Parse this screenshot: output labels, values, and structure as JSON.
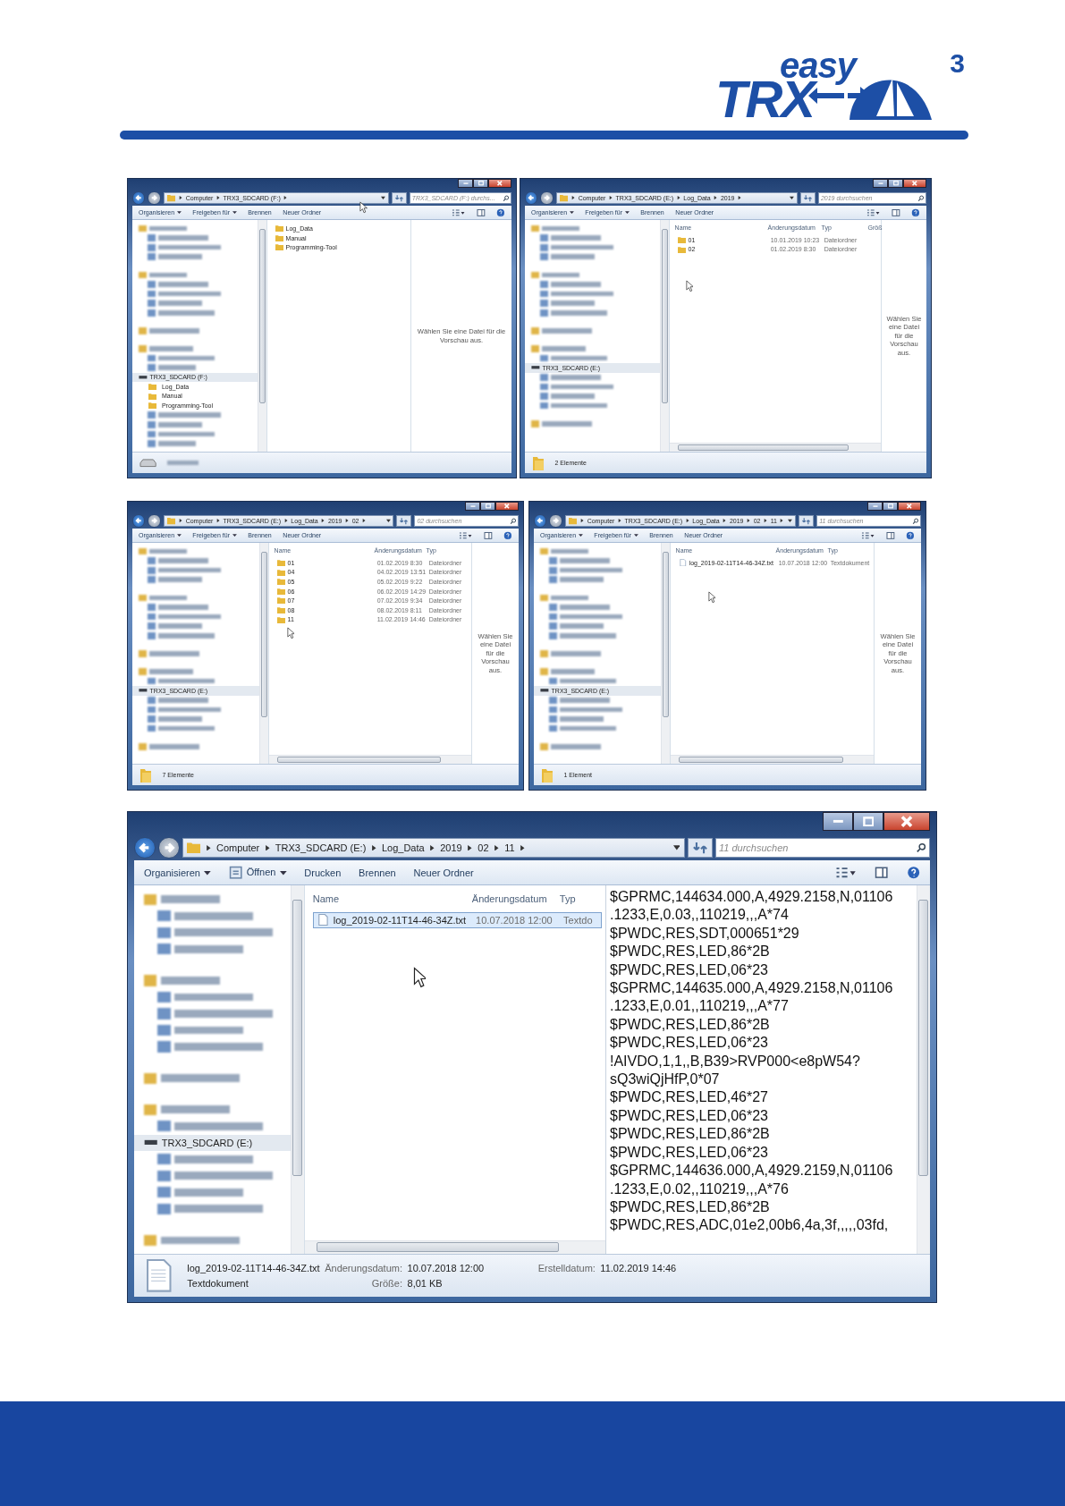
{
  "logo": {
    "top": "easy",
    "main": "TRX",
    "sup": "3"
  },
  "windows": [
    {
      "breadcrumbs": [
        "Computer",
        "TRX3_SDCARD (F:)"
      ],
      "search": {
        "placeholder": "TRX3_SDCARD (F:) durchs..."
      },
      "toolbar": [
        {
          "label": "Organisieren",
          "menu": true
        },
        {
          "label": "Freigeben für",
          "menu": true
        },
        {
          "label": "Brennen",
          "menu": false
        },
        {
          "label": "Neuer Ordner",
          "menu": false
        }
      ],
      "sidebar": [
        {
          "kind": "group"
        },
        {
          "kind": "blurred"
        },
        {
          "kind": "blurred"
        },
        {
          "kind": "blurred"
        },
        {
          "kind": "gap"
        },
        {
          "kind": "group"
        },
        {
          "kind": "blurred"
        },
        {
          "kind": "blurred"
        },
        {
          "kind": "blurred"
        },
        {
          "kind": "blurred"
        },
        {
          "kind": "gap"
        },
        {
          "kind": "group"
        },
        {
          "kind": "gap"
        },
        {
          "kind": "group"
        },
        {
          "kind": "blurred"
        },
        {
          "kind": "blurred"
        },
        {
          "kind": "drive",
          "label": "TRX3_SDCARD (F:)",
          "selected": true,
          "children": [
            {
              "label": "Log_Data"
            },
            {
              "label": "Manual"
            },
            {
              "label": "Programming-Tool"
            }
          ]
        },
        {
          "kind": "blurred"
        },
        {
          "kind": "blurred"
        },
        {
          "kind": "blurred"
        },
        {
          "kind": "blurred"
        }
      ],
      "rows": [
        {
          "kind": "folder",
          "name": "Log_Data",
          "selected": false
        },
        {
          "kind": "folder",
          "name": "Manual",
          "selected": false
        },
        {
          "kind": "folder",
          "name": "Programming-Tool",
          "selected": false
        }
      ],
      "preview": {
        "kind": "hint",
        "text": "Wählen Sie eine Datei für die Vorschau aus."
      },
      "status": {
        "kind": "drive"
      }
    },
    {
      "breadcrumbs": [
        "Computer",
        "TRX3_SDCARD (E:)",
        "Log_Data",
        "2019"
      ],
      "search": {
        "placeholder": "2019 durchsuchen"
      },
      "toolbar": [
        {
          "label": "Organisieren",
          "menu": true
        },
        {
          "label": "Freigeben für",
          "menu": true
        },
        {
          "label": "Brennen",
          "menu": false
        },
        {
          "label": "Neuer Ordner",
          "menu": false
        }
      ],
      "sidebar": [
        {
          "kind": "group"
        },
        {
          "kind": "blurred"
        },
        {
          "kind": "blurred"
        },
        {
          "kind": "blurred"
        },
        {
          "kind": "gap"
        },
        {
          "kind": "group"
        },
        {
          "kind": "blurred"
        },
        {
          "kind": "blurred"
        },
        {
          "kind": "blurred"
        },
        {
          "kind": "blurred"
        },
        {
          "kind": "gap"
        },
        {
          "kind": "group"
        },
        {
          "kind": "gap"
        },
        {
          "kind": "group"
        },
        {
          "kind": "blurred"
        },
        {
          "kind": "drive",
          "label": "TRX3_SDCARD (E:)",
          "selected": true
        },
        {
          "kind": "blurred"
        },
        {
          "kind": "blurred"
        },
        {
          "kind": "blurred"
        },
        {
          "kind": "blurred"
        },
        {
          "kind": "gap"
        },
        {
          "kind": "group"
        }
      ],
      "columns": [
        "Name",
        "Änderungsdatum",
        "Typ",
        "Größ"
      ],
      "rows": [
        {
          "kind": "folder",
          "name": "01",
          "date": "10.01.2019 10:23",
          "type": "Dateiordner",
          "selected": false
        },
        {
          "kind": "folder",
          "name": "02",
          "date": "01.02.2019 8:30",
          "type": "Dateiordner",
          "selected": false
        }
      ],
      "preview": {
        "kind": "hint",
        "text": "Wählen Sie eine Datei für die Vorschau aus."
      },
      "status": {
        "kind": "folder",
        "text": "2 Elemente"
      }
    },
    {
      "breadcrumbs": [
        "Computer",
        "TRX3_SDCARD (E:)",
        "Log_Data",
        "2019",
        "02"
      ],
      "search": {
        "placeholder": "02 durchsuchen"
      },
      "toolbar": [
        {
          "label": "Organisieren",
          "menu": true
        },
        {
          "label": "Freigeben für",
          "menu": true
        },
        {
          "label": "Brennen",
          "menu": false
        },
        {
          "label": "Neuer Ordner",
          "menu": false
        }
      ],
      "sidebar": [
        {
          "kind": "group"
        },
        {
          "kind": "blurred"
        },
        {
          "kind": "blurred"
        },
        {
          "kind": "blurred"
        },
        {
          "kind": "gap"
        },
        {
          "kind": "group"
        },
        {
          "kind": "blurred"
        },
        {
          "kind": "blurred"
        },
        {
          "kind": "blurred"
        },
        {
          "kind": "blurred"
        },
        {
          "kind": "gap"
        },
        {
          "kind": "group"
        },
        {
          "kind": "gap"
        },
        {
          "kind": "group"
        },
        {
          "kind": "blurred"
        },
        {
          "kind": "drive",
          "label": "TRX3_SDCARD (E:)",
          "selected": true
        },
        {
          "kind": "blurred"
        },
        {
          "kind": "blurred"
        },
        {
          "kind": "blurred"
        },
        {
          "kind": "blurred"
        },
        {
          "kind": "gap"
        },
        {
          "kind": "group"
        }
      ],
      "columns": [
        "Name",
        "Änderungsdatum",
        "Typ"
      ],
      "rows": [
        {
          "kind": "folder",
          "name": "01",
          "date": "01.02.2019 8:30",
          "type": "Dateiordner",
          "selected": false
        },
        {
          "kind": "folder",
          "name": "04",
          "date": "04.02.2019 13:51",
          "type": "Dateiordner",
          "selected": false
        },
        {
          "kind": "folder",
          "name": "05",
          "date": "05.02.2019 9:22",
          "type": "Dateiordner",
          "selected": false
        },
        {
          "kind": "folder",
          "name": "06",
          "date": "06.02.2019 14:29",
          "type": "Dateiordner",
          "selected": false
        },
        {
          "kind": "folder",
          "name": "07",
          "date": "07.02.2019 9:34",
          "type": "Dateiordner",
          "selected": false
        },
        {
          "kind": "folder",
          "name": "08",
          "date": "08.02.2019 8:11",
          "type": "Dateiordner",
          "selected": false
        },
        {
          "kind": "folder",
          "name": "11",
          "date": "11.02.2019 14:46",
          "type": "Dateiordner",
          "selected": false
        }
      ],
      "preview": {
        "kind": "hint",
        "text": "Wählen Sie eine Datei für die Vorschau aus."
      },
      "status": {
        "kind": "folder",
        "text": "7 Elemente"
      }
    },
    {
      "breadcrumbs": [
        "Computer",
        "TRX3_SDCARD (E:)",
        "Log_Data",
        "2019",
        "02",
        "11"
      ],
      "search": {
        "placeholder": "11 durchsuchen"
      },
      "toolbar": [
        {
          "label": "Organisieren",
          "menu": true
        },
        {
          "label": "Freigeben für",
          "menu": true
        },
        {
          "label": "Brennen",
          "menu": false
        },
        {
          "label": "Neuer Ordner",
          "menu": false
        }
      ],
      "sidebar": [
        {
          "kind": "group"
        },
        {
          "kind": "blurred"
        },
        {
          "kind": "blurred"
        },
        {
          "kind": "blurred"
        },
        {
          "kind": "gap"
        },
        {
          "kind": "group"
        },
        {
          "kind": "blurred"
        },
        {
          "kind": "blurred"
        },
        {
          "kind": "blurred"
        },
        {
          "kind": "blurred"
        },
        {
          "kind": "gap"
        },
        {
          "kind": "group"
        },
        {
          "kind": "gap"
        },
        {
          "kind": "group"
        },
        {
          "kind": "blurred"
        },
        {
          "kind": "drive",
          "label": "TRX3_SDCARD (E:)",
          "selected": true
        },
        {
          "kind": "blurred"
        },
        {
          "kind": "blurred"
        },
        {
          "kind": "blurred"
        },
        {
          "kind": "blurred"
        },
        {
          "kind": "gap"
        },
        {
          "kind": "group"
        }
      ],
      "columns": [
        "Name",
        "Änderungsdatum",
        "Typ"
      ],
      "rows": [
        {
          "kind": "file",
          "name": "log_2019-02-11T14-46-34Z.txt",
          "date": "10.07.2018 12:00",
          "type": "Textdokument",
          "selected": false
        }
      ],
      "preview": {
        "kind": "hint",
        "text": "Wählen Sie eine Datei für die Vorschau aus."
      },
      "status": {
        "kind": "folder",
        "text": "1 Element"
      }
    },
    {
      "breadcrumbs": [
        "Computer",
        "TRX3_SDCARD (E:)",
        "Log_Data",
        "2019",
        "02",
        "11"
      ],
      "search": {
        "placeholder": "11 durchsuchen"
      },
      "toolbar": [
        {
          "label": "Organisieren",
          "menu": true
        },
        {
          "label": "Öffnen",
          "menu": true,
          "icon": true
        },
        {
          "label": "Drucken",
          "menu": false
        },
        {
          "label": "Brennen",
          "menu": false
        },
        {
          "label": "Neuer Ordner",
          "menu": false
        }
      ],
      "sidebar": [
        {
          "kind": "group"
        },
        {
          "kind": "blurred"
        },
        {
          "kind": "blurred"
        },
        {
          "kind": "blurred"
        },
        {
          "kind": "gap"
        },
        {
          "kind": "group"
        },
        {
          "kind": "blurred"
        },
        {
          "kind": "blurred"
        },
        {
          "kind": "blurred"
        },
        {
          "kind": "blurred"
        },
        {
          "kind": "gap"
        },
        {
          "kind": "group"
        },
        {
          "kind": "gap"
        },
        {
          "kind": "group"
        },
        {
          "kind": "blurred"
        },
        {
          "kind": "drive",
          "label": "TRX3_SDCARD (E:)",
          "selected": true
        },
        {
          "kind": "blurred"
        },
        {
          "kind": "blurred"
        },
        {
          "kind": "blurred"
        },
        {
          "kind": "blurred"
        },
        {
          "kind": "gap"
        },
        {
          "kind": "group"
        }
      ],
      "columns": [
        "Name",
        "Änderungsdatum",
        "Typ"
      ],
      "rows": [
        {
          "kind": "file",
          "name": "log_2019-02-11T14-46-34Z.txt",
          "date": "10.07.2018 12:00",
          "type": "Textdo",
          "selected": true
        }
      ],
      "preview": {
        "kind": "log",
        "lines": [
          "$GPRMC,144634.000,A,4929.2158,N,01106",
          ".1233,E,0.03,,110219,,,A*74",
          "$PWDC,RES,SDT,000651*29",
          "$PWDC,RES,LED,86*2B",
          "$PWDC,RES,LED,06*23",
          "$GPRMC,144635.000,A,4929.2158,N,01106",
          ".1233,E,0.01,,110219,,,A*77",
          "$PWDC,RES,LED,86*2B",
          "$PWDC,RES,LED,06*23",
          "!AIVDO,1,1,,B,B39>RVP000<e8pW54?",
          "sQ3wiQjHfP,0*07",
          "$PWDC,RES,LED,46*27",
          "$PWDC,RES,LED,06*23",
          "$PWDC,RES,LED,86*2B",
          "$PWDC,RES,LED,06*23",
          "$GPRMC,144636.000,A,4929.2159,N,01106",
          ".1233,E,0.02,,110219,,,A*76",
          "$PWDC,RES,LED,86*2B",
          "$PWDC,RES,ADC,01e2,00b6,4a,3f,,,,,03fd,"
        ]
      },
      "status": {
        "kind": "file",
        "name": "log_2019-02-11T14-46-34Z.txt",
        "type": "Textdokument",
        "details": [
          {
            "label": "Änderungsdatum:",
            "value": "10.07.2018 12:00"
          },
          {
            "label": "Größe:",
            "value": "8,01 KB"
          },
          {
            "label": "Erstelldatum:",
            "value": "11.02.2019 14:46"
          }
        ]
      }
    }
  ]
}
